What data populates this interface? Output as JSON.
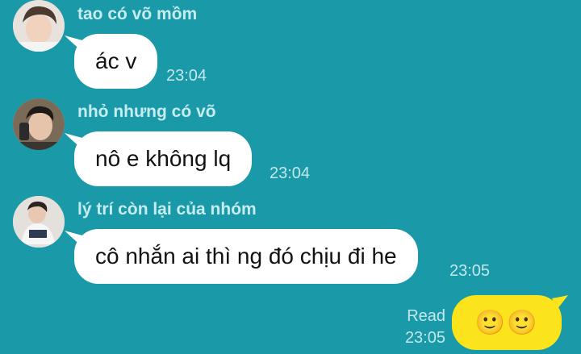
{
  "messages": [
    {
      "sender": "tao có võ mồm",
      "text": "ác v",
      "time": "23:04"
    },
    {
      "sender": "nhỏ nhưng có võ",
      "text": "nô e không lq",
      "time": "23:04"
    },
    {
      "sender": "lý trí còn lại của nhóm",
      "text": "cô nhắn ai thì ng đó chịu đi he",
      "time": "23:05"
    }
  ],
  "my_message": {
    "content": "🙂🙂",
    "status": "Read",
    "time": "23:05"
  },
  "colors": {
    "background": "#1a9aa8",
    "incoming_bubble": "#ffffff",
    "outgoing_bubble": "#fbe41c"
  }
}
